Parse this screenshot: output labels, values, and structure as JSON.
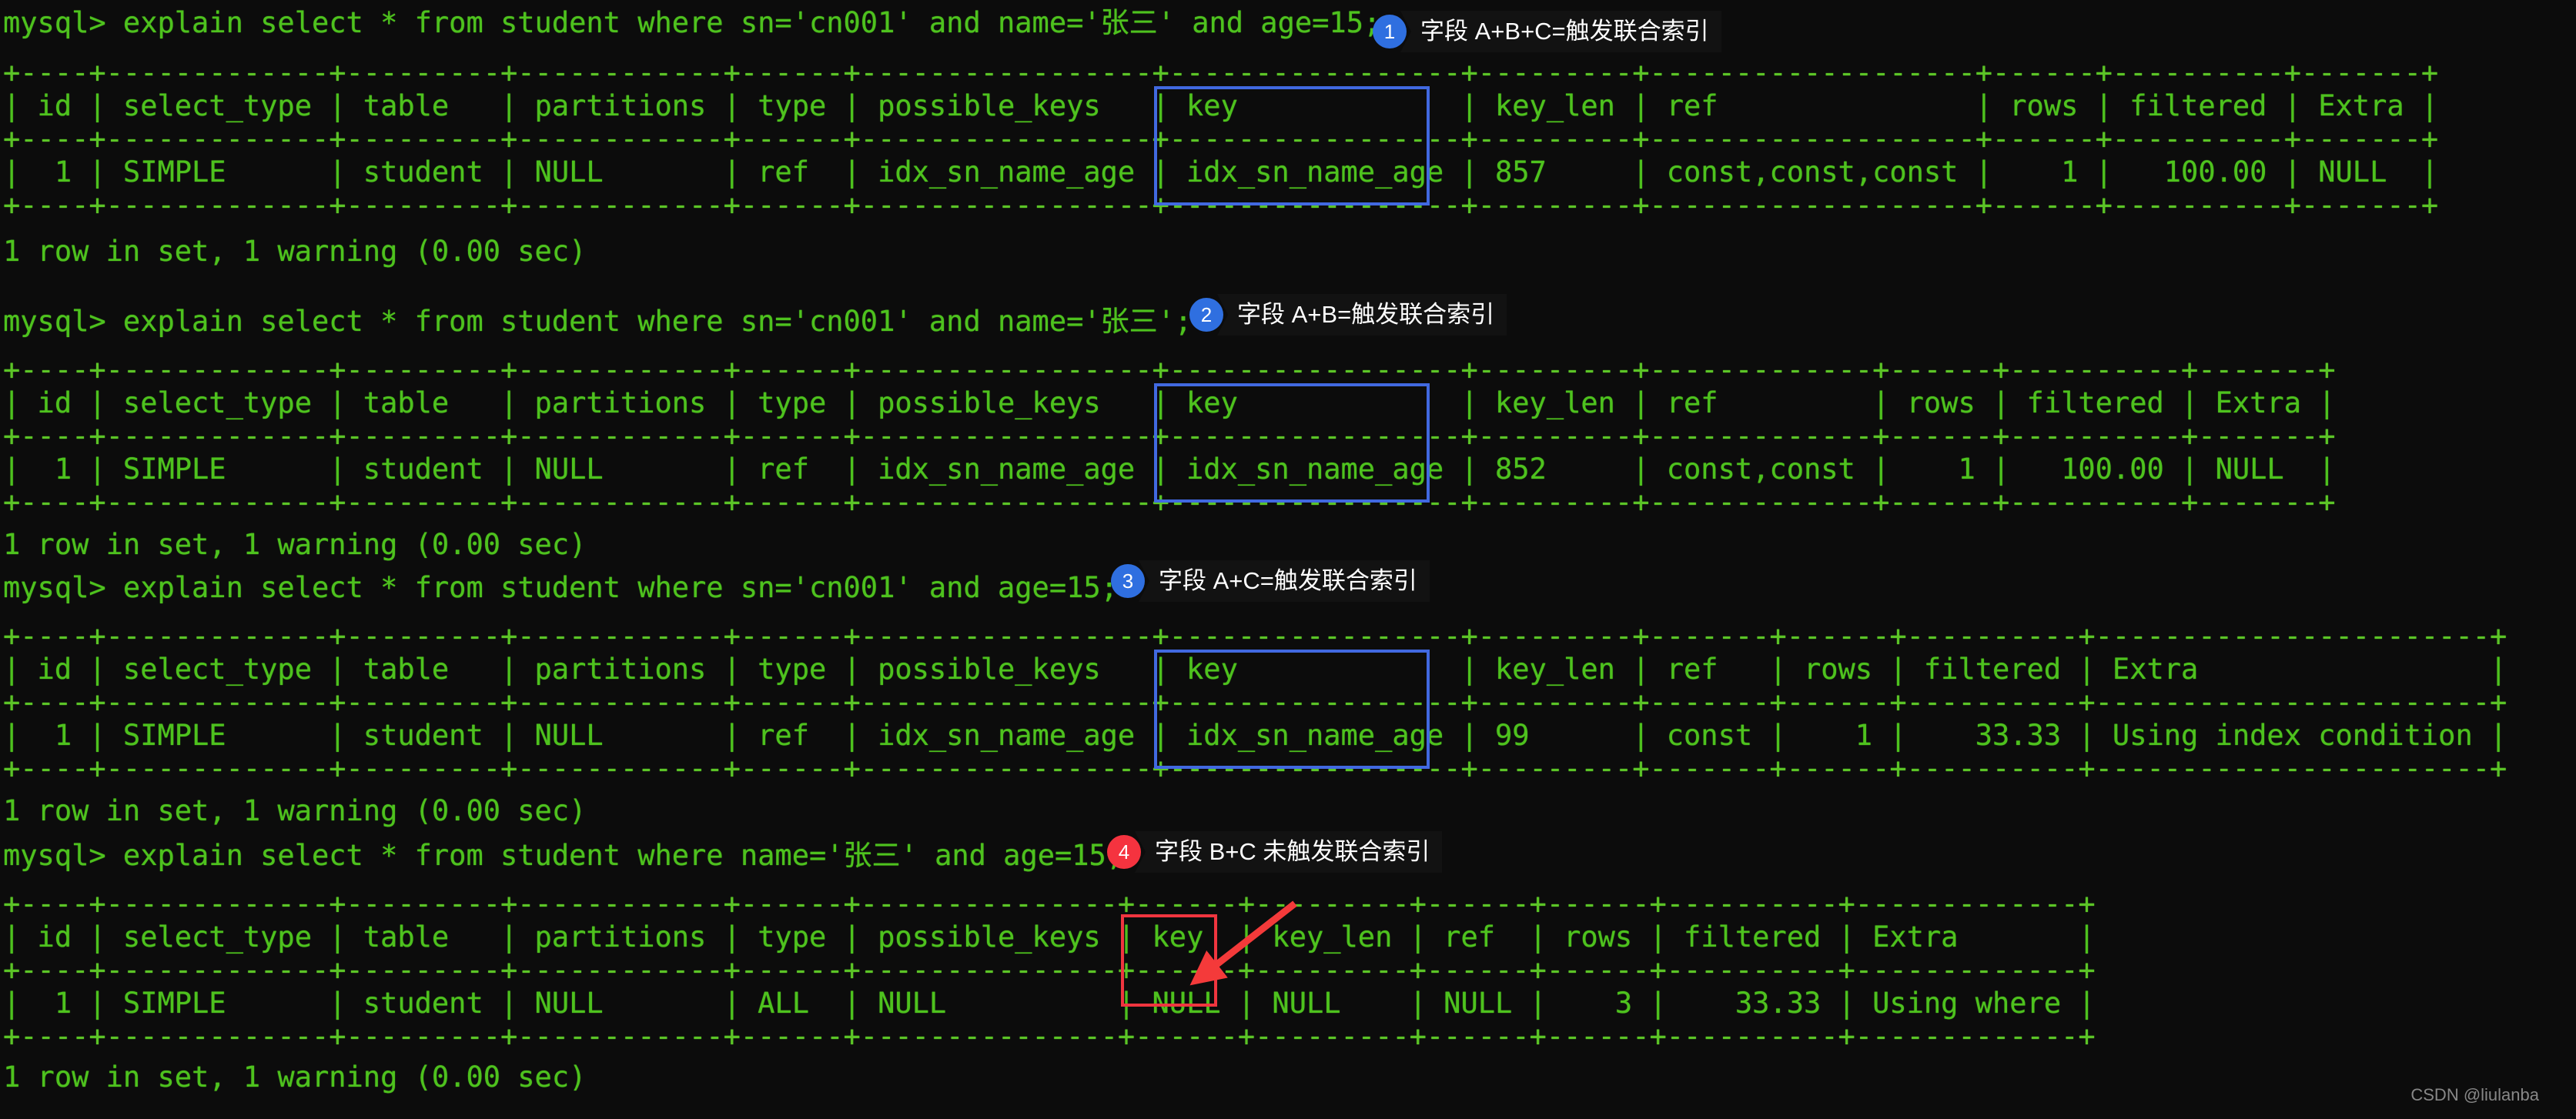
{
  "terminal": {
    "prompt": "mysql>",
    "foreground_color": "#4ec21e",
    "background_color": "#0c0c0c",
    "blocks": [
      {
        "query": "mysql> explain select * from student where sn='cn001' and name='张三' and age=15;",
        "rule_top": "+----+-------------+---------+------------+------+-----------------+-----------------+---------+-------------------+------+----------+-------+",
        "header": "| id | select_type | table   | partitions | type | possible_keys   | key             | key_len | ref               | rows | filtered | Extra |",
        "rule_mid": "+----+-------------+---------+------------+------+-----------------+-----------------+---------+-------------------+------+----------+-------+",
        "row": "|  1 | SIMPLE      | student | NULL       | ref  | idx_sn_name_age | idx_sn_name_age | 857     | const,const,const |    1 |   100.00 | NULL  |",
        "rule_bottom": "+----+-------------+---------+------------+------+-----------------+-----------------+---------+-------------------+------+----------+-------+",
        "result": "1 row in set, 1 warning (0.00 sec)"
      },
      {
        "query": "mysql> explain select * from student where sn='cn001' and name='张三';",
        "rule_top": "+----+-------------+---------+------------+------+-----------------+-----------------+---------+-------------+------+----------+-------+",
        "header": "| id | select_type | table   | partitions | type | possible_keys   | key             | key_len | ref         | rows | filtered | Extra |",
        "rule_mid": "+----+-------------+---------+------------+------+-----------------+-----------------+---------+-------------+------+----------+-------+",
        "row": "|  1 | SIMPLE      | student | NULL       | ref  | idx_sn_name_age | idx_sn_name_age | 852     | const,const |    1 |   100.00 | NULL  |",
        "rule_bottom": "+----+-------------+---------+------------+------+-----------------+-----------------+---------+-------------+------+----------+-------+",
        "result": "1 row in set, 1 warning (0.00 sec)"
      },
      {
        "query": "mysql> explain select * from student where sn='cn001' and age=15;",
        "rule_top": "+----+-------------+---------+------------+------+-----------------+-----------------+---------+-------+------+----------+-----------------------+",
        "header": "| id | select_type | table   | partitions | type | possible_keys   | key             | key_len | ref   | rows | filtered | Extra                 |",
        "rule_mid": "+----+-------------+---------+------------+------+-----------------+-----------------+---------+-------+------+----------+-----------------------+",
        "row": "|  1 | SIMPLE      | student | NULL       | ref  | idx_sn_name_age | idx_sn_name_age | 99      | const |    1 |    33.33 | Using index condition |",
        "rule_bottom": "+----+-------------+---------+------------+------+-----------------+-----------------+---------+-------+------+----------+-----------------------+",
        "result": "1 row in set, 1 warning (0.00 sec)"
      },
      {
        "query": "mysql> explain select * from student where name='张三' and age=15;",
        "rule_top": "+----+-------------+---------+------------+------+---------------+------+---------+------+------+----------+-------------+",
        "header": "| id | select_type | table   | partitions | type | possible_keys | key  | key_len | ref  | rows | filtered | Extra       |",
        "rule_mid": "+----+-------------+---------+------------+------+---------------+------+---------+------+------+----------+-------------+",
        "row": "|  1 | SIMPLE      | student | NULL       | ALL  | NULL          | NULL | NULL    | NULL |    3 |    33.33 | Using where |",
        "rule_bottom": "+----+-------------+---------+------------+------+---------------+------+---------+------+------+----------+-------------+",
        "result": "1 row in set, 1 warning (0.00 sec)"
      }
    ]
  },
  "annotations": [
    {
      "number": "1",
      "text": "字段 A+B+C=触发联合索引",
      "color": "#2f6fe0",
      "style": "blue"
    },
    {
      "number": "2",
      "text": "字段 A+B=触发联合索引",
      "color": "#2f6fe0",
      "style": "blue"
    },
    {
      "number": "3",
      "text": "字段 A+C=触发联合索引",
      "color": "#2f6fe0",
      "style": "blue"
    },
    {
      "number": "4",
      "text": "字段 B+C 未触发联合索引",
      "color": "#f5333f",
      "style": "red"
    }
  ],
  "highlights": {
    "blue_color": "#4169e1",
    "red_color": "#f0353f",
    "arrow_color": "#f43a3a",
    "note": "key column boxed in each EXPLAIN result"
  },
  "watermark": "CSDN @liulanba"
}
